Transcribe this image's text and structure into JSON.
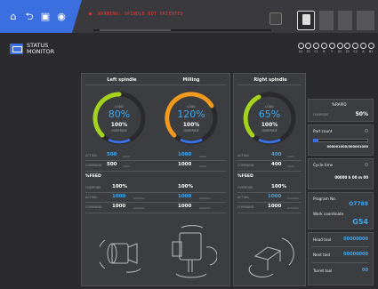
{
  "topbar": {
    "alarm_text": "WARNING: SPINDLE NOT ORIENTED",
    "nav_icons": [
      "home-icon",
      "back-icon",
      "lock-icon",
      "camera-icon"
    ]
  },
  "header": {
    "title_line1": "STATUS",
    "title_line2": "MONITOR",
    "axes": [
      "X1",
      "Z1",
      "C1",
      "B",
      "Y",
      "X2",
      "Z2",
      "C2",
      "A",
      "B1"
    ]
  },
  "spindles": [
    {
      "title": "Left spindle",
      "load_label": "LOAD",
      "load": "80%",
      "override": "100%",
      "override_label": "OVERRIDE",
      "actual_label": "ACTUAL",
      "actual": "500",
      "actual_unit": "r/min",
      "command_label": "COMMAND",
      "command": "500",
      "command_unit": "r/min"
    },
    {
      "title": "Milling",
      "load_label": "LOAD",
      "load": "120%",
      "override": "100%",
      "override_label": "OVERRIDE",
      "actual_label": "",
      "actual": "1000",
      "actual_unit": "r/min",
      "command_label": "",
      "command": "1000",
      "command_unit": "r/min"
    },
    {
      "title": "Right spindle",
      "load_label": "LOAD",
      "load": "65%",
      "override": "100%",
      "override_label": "OVERRIDE",
      "actual_label": "ACTUAL",
      "actual": "400",
      "actual_unit": "r/min",
      "command_label": "COMMAND",
      "command": "400",
      "command_unit": "r/min"
    }
  ],
  "feed_left": {
    "title": "%FEED",
    "override_label": "OVERRIDE",
    "override_a": "100%",
    "override_b": "100%",
    "actual_label": "ACTUAL",
    "actual_a": "1000",
    "actual_b": "1000",
    "unit": "mm/min",
    "command_label": "COMMAND",
    "command_a": "1000",
    "command_b": "1000"
  },
  "feed_right": {
    "title": "%FEED",
    "override_label": "OVERRIDE",
    "override": "100%",
    "actual_label": "ACTUAL",
    "actual": "1000",
    "unit": "mm/min",
    "command_label": "COMMAND",
    "command": "1000"
  },
  "right_col": {
    "rapid_title": "%RAPID",
    "rapid_label": "OVERRIDE",
    "rapid_value": "50%",
    "part_count_title": "Part count",
    "part_count": "000001000/000001000",
    "cycle_time_title": "Cycle time",
    "cycle_time": "00000 h 00 m 00",
    "program_title": "Program No.",
    "program_value": "O7788",
    "work_title": "Work coordinate",
    "work_value": "G54",
    "head_tool_title": "Head tool",
    "head_tool": "00000000",
    "next_tool_title": "Next tool",
    "next_tool": "00000000",
    "turret_tool_title": "Turret tool",
    "turret_tool": "00"
  },
  "colors": {
    "accent": "#3b6fe0",
    "value_blue": "#3aa8f0",
    "gauge_green": "#a4d21e",
    "gauge_orange": "#f09a1e",
    "alarm": "#e23b3b"
  }
}
